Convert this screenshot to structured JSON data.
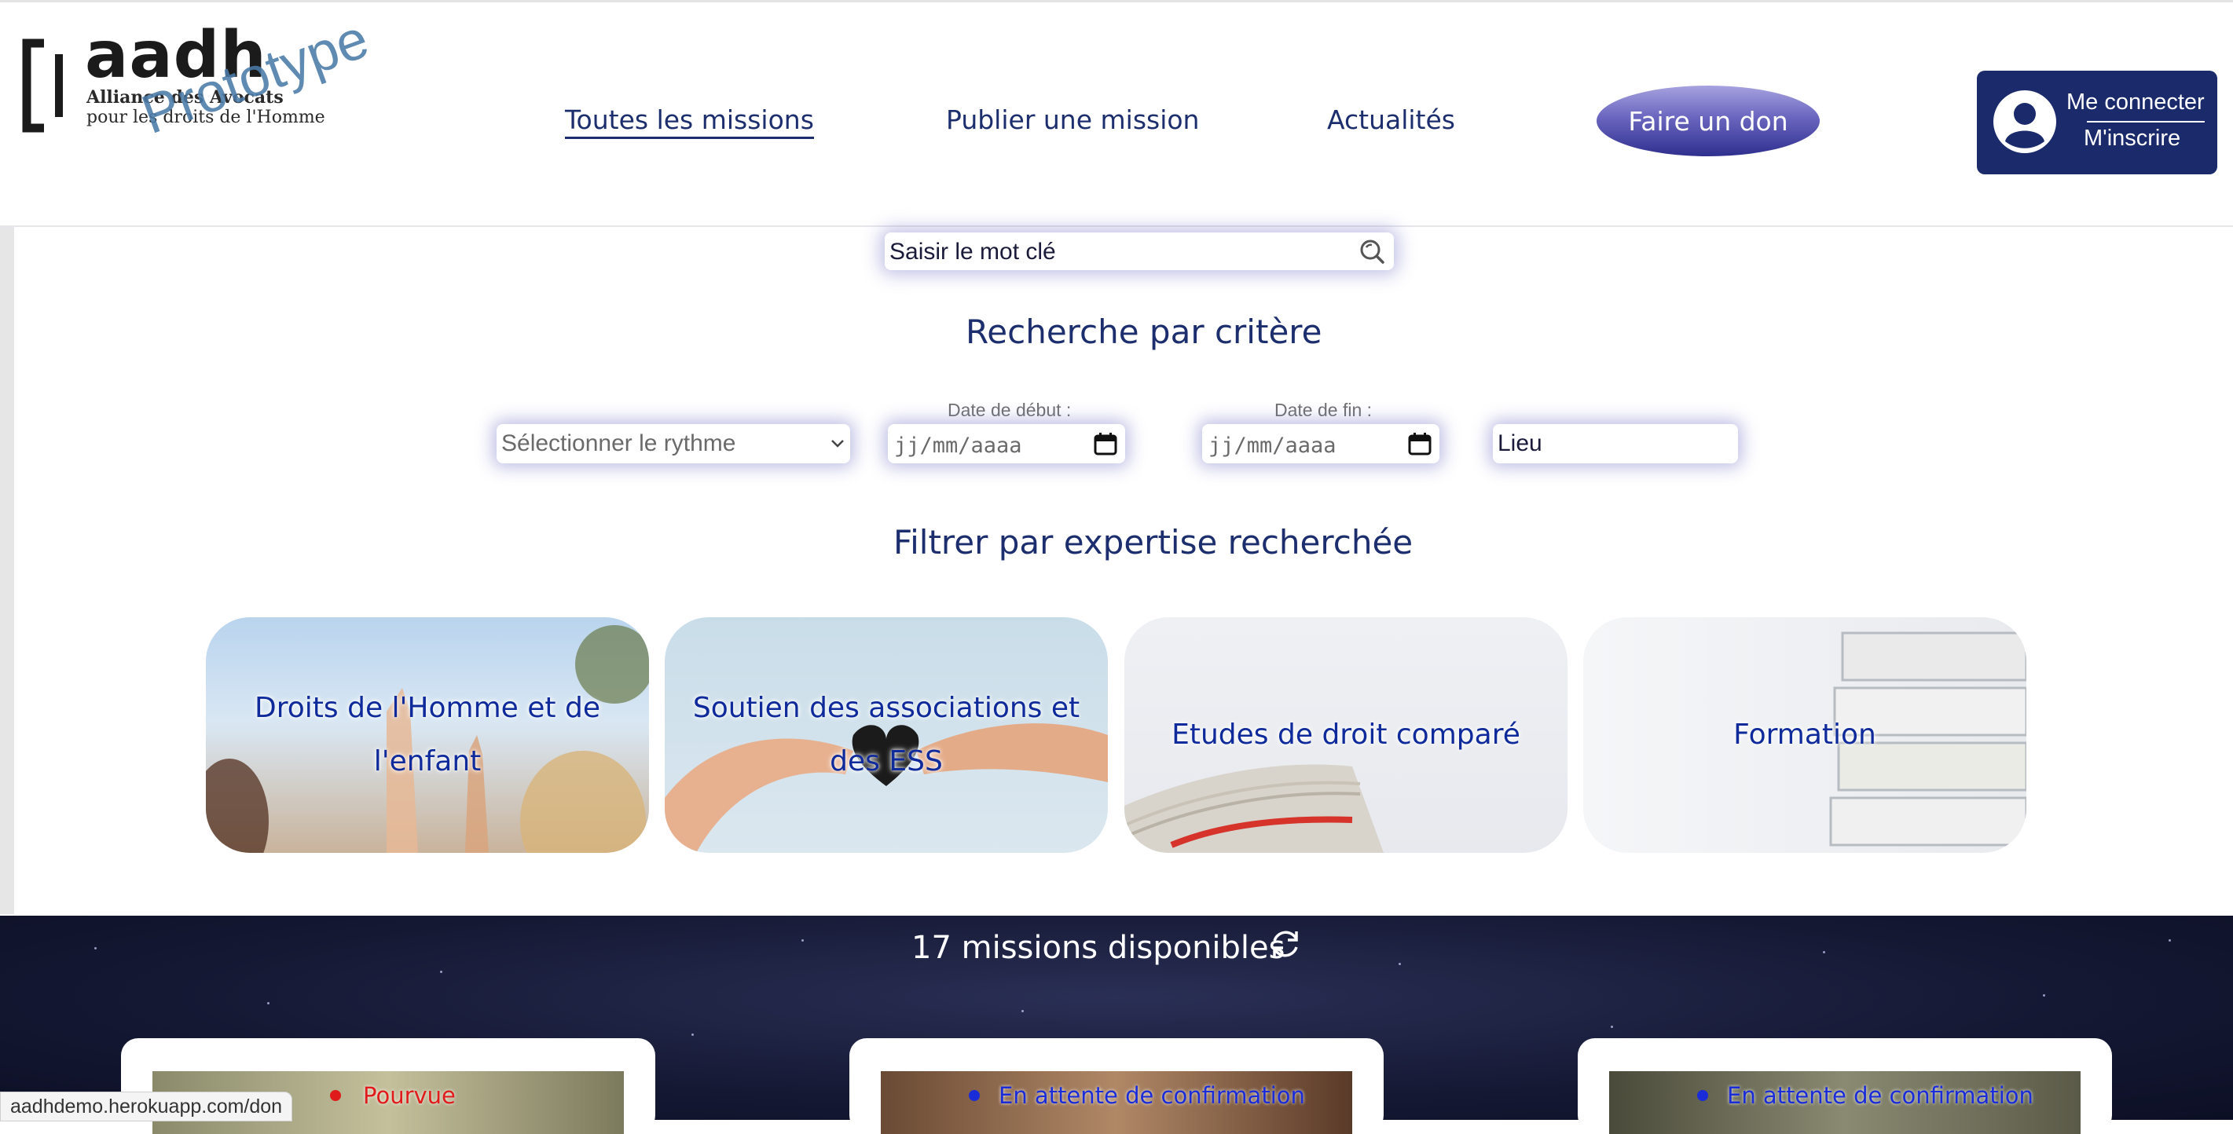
{
  "brand": {
    "name": "aadh",
    "line1": "Alliance des Avocats",
    "line2": "pour les droits de l'Homme",
    "watermark": "Prototype"
  },
  "nav": {
    "items": [
      "Toutes les missions",
      "Publier une mission",
      "Actualités"
    ],
    "active_index": 0,
    "donate": "Faire un don"
  },
  "account": {
    "login": "Me connecter",
    "register": "M'inscrire"
  },
  "search": {
    "placeholder": "Saisir le mot clé"
  },
  "criteria": {
    "heading": "Recherche par critère",
    "rhythm_placeholder": "Sélectionner le rythme",
    "start_label": "Date de début :",
    "end_label": "Date de fin :",
    "date_placeholder": "jj/mm/aaaa",
    "place_placeholder": "Lieu"
  },
  "expertise": {
    "heading": "Filtrer par expertise recherchée",
    "cards": [
      {
        "title": "Droits de l'Homme et de l'enfant"
      },
      {
        "title": "Soutien des associations et des ESS"
      },
      {
        "title": "Etudes de droit comparé"
      },
      {
        "title": "Formation"
      }
    ]
  },
  "missions": {
    "count_text": "17 missions disponibles",
    "cards": [
      {
        "status": "Pourvue",
        "status_color": "#e01b1b"
      },
      {
        "status": "En attente de confirmation",
        "status_color": "#1a2bd8"
      },
      {
        "status": "En attente de confirmation",
        "status_color": "#1a2bd8"
      }
    ]
  },
  "statusbar": {
    "url": "aadhdemo.herokuapp.com/don"
  },
  "colors": {
    "navy": "#1c2e6e",
    "account_bg": "#1a2a6b",
    "card_text": "#0f2a9a"
  }
}
